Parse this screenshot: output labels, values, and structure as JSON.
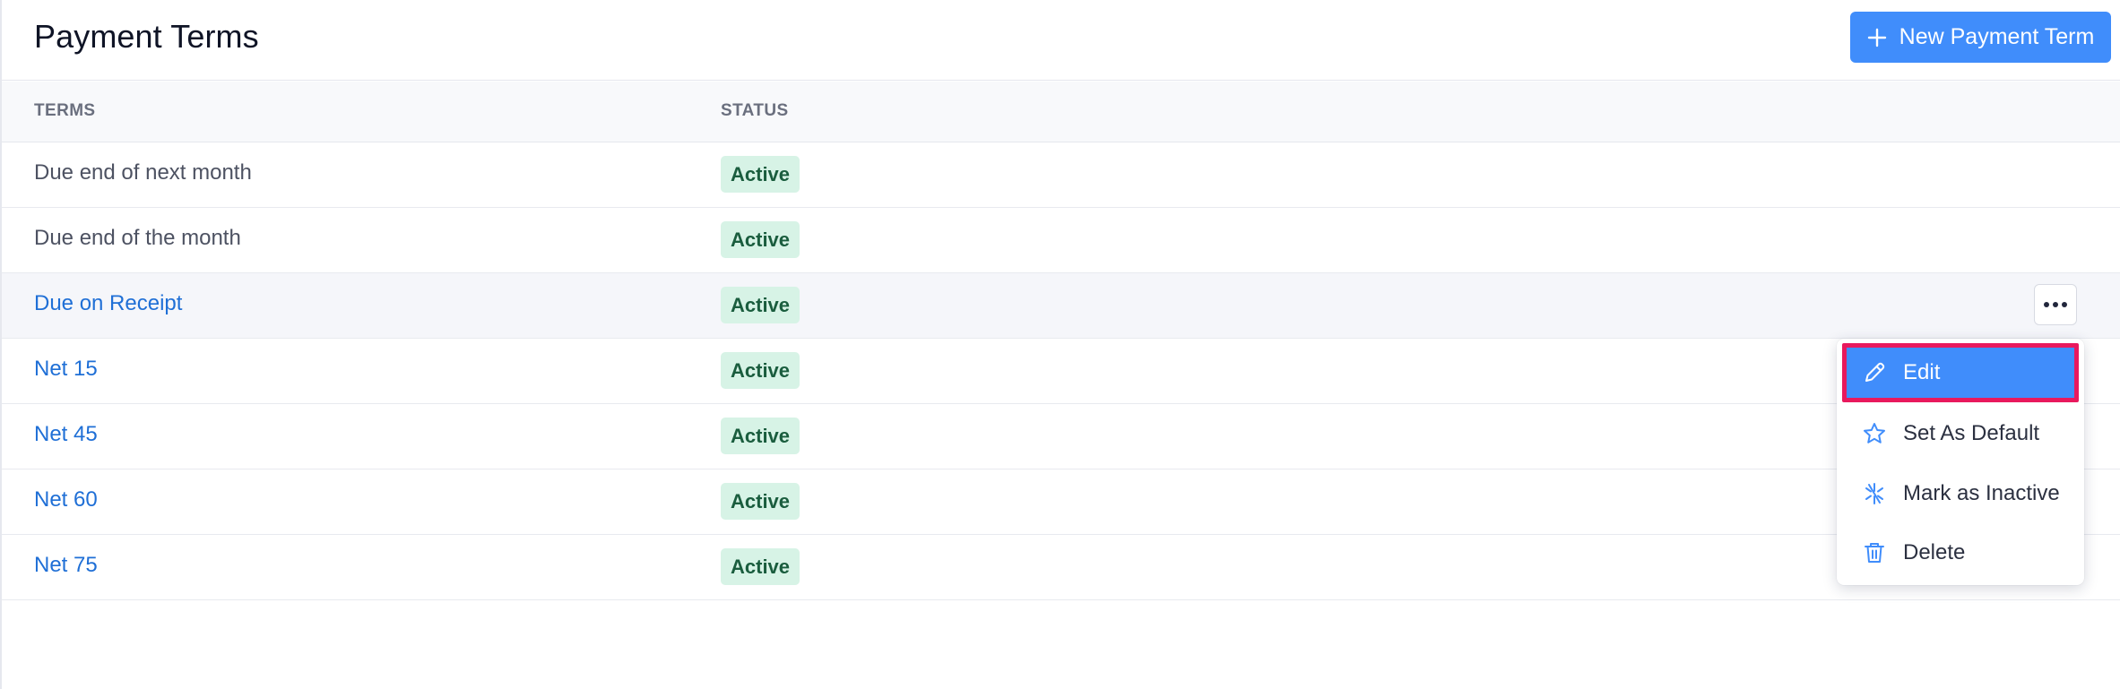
{
  "header": {
    "title": "Payment Terms",
    "new_button_label": "New Payment Term"
  },
  "table": {
    "columns": {
      "terms": "TERMS",
      "status": "STATUS"
    },
    "rows": [
      {
        "term": "Due end of next month",
        "status": "Active"
      },
      {
        "term": "Due end of the month",
        "status": "Active"
      },
      {
        "term": "Due on Receipt",
        "status": "Active"
      },
      {
        "term": "Net 15",
        "status": "Active"
      },
      {
        "term": "Net 45",
        "status": "Active"
      },
      {
        "term": "Net 60",
        "status": "Active"
      },
      {
        "term": "Net 75",
        "status": "Active"
      }
    ]
  },
  "row_menu": {
    "trigger_icon": "more-horizontal-icon",
    "items": [
      {
        "label": "Edit",
        "icon": "pencil-icon",
        "highlighted": true
      },
      {
        "label": "Set As Default",
        "icon": "star-icon",
        "highlighted": false
      },
      {
        "label": "Mark as Inactive",
        "icon": "inactive-icon",
        "highlighted": false
      },
      {
        "label": "Delete",
        "icon": "trash-icon",
        "highlighted": false
      }
    ]
  },
  "colors": {
    "accent": "#408dfb",
    "link": "#1f6fd6",
    "badge_bg": "#d7f3e6",
    "badge_text": "#1a5d3e",
    "highlight_border": "#e8195d"
  }
}
